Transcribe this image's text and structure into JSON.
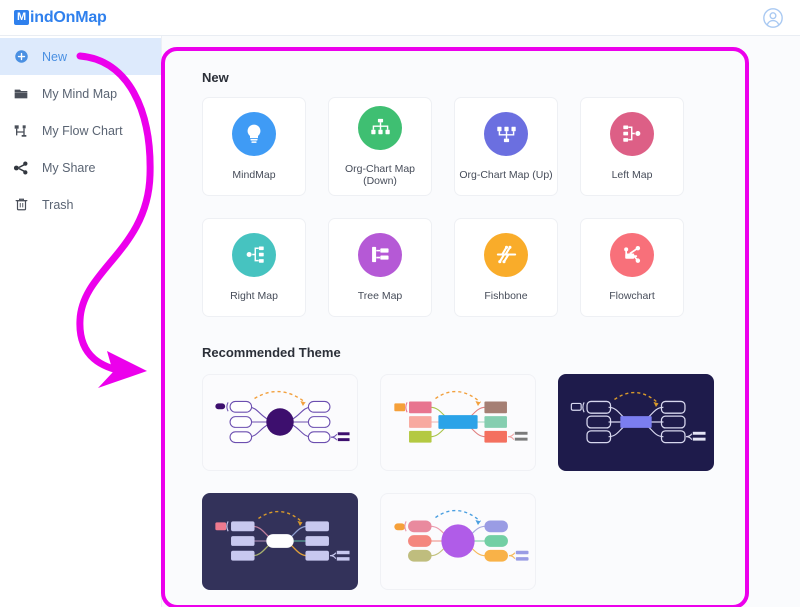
{
  "header": {
    "logo_badge": "M",
    "logo_text": "indOnMap",
    "avatar_icon": "user-circle-icon"
  },
  "sidebar": {
    "items": [
      {
        "label": "New",
        "icon": "plus-circle-icon",
        "active": true
      },
      {
        "label": "My Mind Map",
        "icon": "folder-icon",
        "active": false
      },
      {
        "label": "My Flow Chart",
        "icon": "flow-chart-icon",
        "active": false
      },
      {
        "label": "My Share",
        "icon": "share-icon",
        "active": false
      },
      {
        "label": "Trash",
        "icon": "trash-icon",
        "active": false
      }
    ]
  },
  "main": {
    "new_section_title": "New",
    "theme_section_title": "Recommended Theme",
    "templates": [
      {
        "label": "MindMap",
        "icon": "lightbulb-icon",
        "color": "#3f9bf5"
      },
      {
        "label": "Org-Chart Map (Down)",
        "icon": "org-chart-down-icon",
        "color": "#3fbf72"
      },
      {
        "label": "Org-Chart Map (Up)",
        "icon": "org-chart-up-icon",
        "color": "#6b6fe0"
      },
      {
        "label": "Left Map",
        "icon": "left-map-icon",
        "color": "#dd5f86"
      },
      {
        "label": "Right Map",
        "icon": "right-map-icon",
        "color": "#46c3c0"
      },
      {
        "label": "Tree Map",
        "icon": "tree-map-icon",
        "color": "#b559d6"
      },
      {
        "label": "Fishbone",
        "icon": "fishbone-icon",
        "color": "#f9ac2a"
      },
      {
        "label": "Flowchart",
        "icon": "flowchart-icon",
        "color": "#f8707a"
      }
    ],
    "themes": [
      {
        "name": "theme-purple-light",
        "background": "#fbfbfd",
        "center": "#3d0f6e",
        "node": "#ffffff",
        "stroke": "#6c4fb0",
        "arrow": "#f2a03d"
      },
      {
        "name": "theme-colorful-light",
        "background": "#fbfbfd",
        "center": "#2ba3e8",
        "node": "#e8748f",
        "stroke": "#e3a5a5",
        "arrow": "#f2a03d"
      },
      {
        "name": "theme-dark-blue",
        "background": "#1e1b4b",
        "center": "#7b7ef0",
        "node": "#1e1b4b",
        "stroke": "#e4e4f5",
        "arrow": "#d99a2b"
      },
      {
        "name": "theme-dark-lavender",
        "background": "#33325a",
        "center": "#ffffff",
        "node": "#c8c8ef",
        "stroke": "#c8c8ef",
        "arrow": "#d99a2b"
      },
      {
        "name": "theme-pastel-purple",
        "background": "#fbfbfd",
        "center": "#b05ce8",
        "node": "#e98a9e",
        "stroke": "#e3a5a5",
        "arrow": "#4a9fe0"
      }
    ]
  },
  "annotations": {
    "highlight_color": "#ec00ec",
    "arrow_color": "#ec00ec",
    "highlight_name": "content-area-highlight",
    "arrow_name": "pointer-arrow"
  }
}
